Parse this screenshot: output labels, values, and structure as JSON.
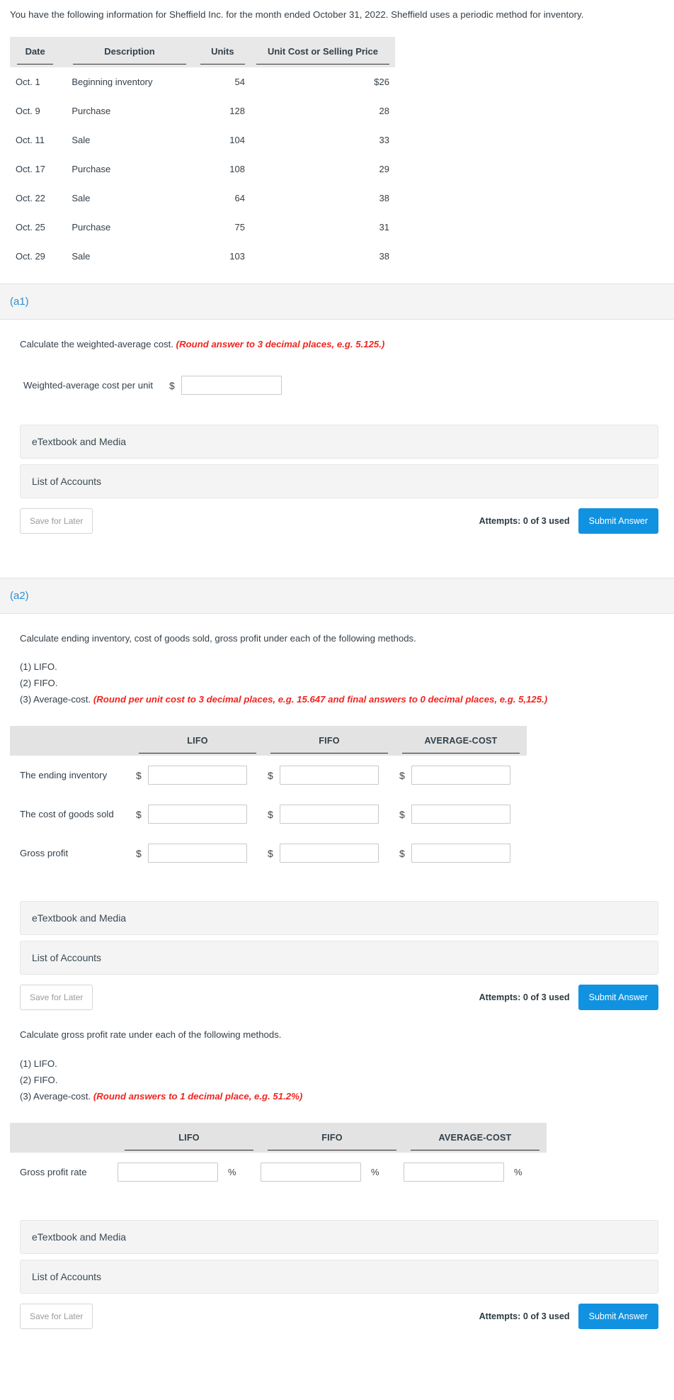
{
  "intro": {
    "text": "You have the following information for Sheffield Inc. for the month ended October 31, 2022. Sheffield uses a periodic method for inventory."
  },
  "inventory_table": {
    "columns": [
      "Date",
      "Description",
      "Units",
      "Unit Cost or Selling Price"
    ],
    "rows": [
      {
        "date": "Oct. 1",
        "description": "Beginning inventory",
        "units": "54",
        "price": "$26"
      },
      {
        "date": "Oct. 9",
        "description": "Purchase",
        "units": "128",
        "price": "28"
      },
      {
        "date": "Oct. 11",
        "description": "Sale",
        "units": "104",
        "price": "33"
      },
      {
        "date": "Oct. 17",
        "description": "Purchase",
        "units": "108",
        "price": "29"
      },
      {
        "date": "Oct. 22",
        "description": "Sale",
        "units": "64",
        "price": "38"
      },
      {
        "date": "Oct. 25",
        "description": "Purchase",
        "units": "75",
        "price": "31"
      },
      {
        "date": "Oct. 29",
        "description": "Sale",
        "units": "103",
        "price": "38"
      }
    ]
  },
  "part_a1": {
    "label": "(a1)",
    "question": "Calculate the weighted-average cost.",
    "round_note": "(Round answer to 3 decimal places, e.g. 5.125.)",
    "answer_label": "Weighted-average cost per unit",
    "currency_symbol": "$",
    "input_value": "",
    "resources": {
      "etextbook": "eTextbook and Media",
      "accounts": "List of Accounts"
    },
    "actions": {
      "save": "Save for Later",
      "attempts": "Attempts: 0 of 3 used",
      "submit": "Submit Answer"
    }
  },
  "part_a2": {
    "label": "(a2)",
    "question": "Calculate ending inventory, cost of goods sold, gross profit under each of the following methods.",
    "methods": [
      {
        "text": "(1) LIFO.",
        "note": ""
      },
      {
        "text": "(2) FIFO.",
        "note": ""
      },
      {
        "text": "(3) Average-cost.",
        "note": "(Round per unit cost to 3 decimal places, e.g. 15.647 and final answers to 0 decimal places, e.g. 5,125.)"
      }
    ],
    "grid": {
      "headers": [
        "",
        "LIFO",
        "FIFO",
        "AVERAGE-COST"
      ],
      "rows": [
        {
          "label": "The ending inventory",
          "currency_symbol": "$",
          "values": [
            "",
            "",
            ""
          ]
        },
        {
          "label": "The cost of goods sold",
          "currency_symbol": "$",
          "values": [
            "",
            "",
            ""
          ]
        },
        {
          "label": "Gross profit",
          "currency_symbol": "$",
          "values": [
            "",
            "",
            ""
          ]
        }
      ]
    },
    "resources": {
      "etextbook": "eTextbook and Media",
      "accounts": "List of Accounts"
    },
    "actions": {
      "save": "Save for Later",
      "attempts": "Attempts: 0 of 3 used",
      "submit": "Submit Answer"
    }
  },
  "part_a3": {
    "question": "Calculate gross profit rate under each of the following methods.",
    "methods": [
      {
        "text": "(1) LIFO.",
        "note": ""
      },
      {
        "text": "(2) FIFO.",
        "note": ""
      },
      {
        "text": "(3) Average-cost.",
        "note": "(Round answers to 1 decimal place, e.g. 51.2%)"
      }
    ],
    "grid": {
      "headers": [
        "",
        "LIFO",
        "FIFO",
        "AVERAGE-COST"
      ],
      "rows": [
        {
          "label": "Gross profit rate",
          "percent_symbol": "%",
          "values": [
            "",
            "",
            ""
          ]
        }
      ]
    },
    "resources": {
      "etextbook": "eTextbook and Media",
      "accounts": "List of Accounts"
    },
    "actions": {
      "save": "Save for Later",
      "attempts": "Attempts: 0 of 3 used",
      "submit": "Submit Answer"
    }
  },
  "colors": {
    "accent_blue": "#1192e0",
    "part_label_blue": "#2b8fd6",
    "note_red": "#f0241f",
    "band_gray": "#f4f4f4",
    "table_header_gray": "#e8e8e8"
  }
}
